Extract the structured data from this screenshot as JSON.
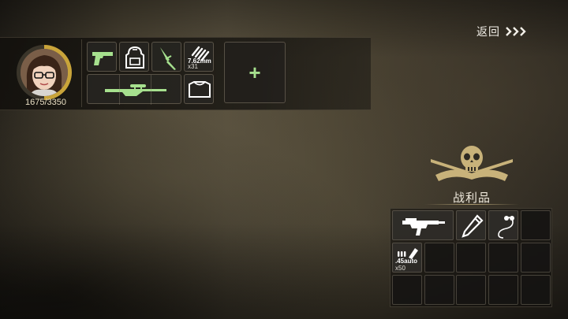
{
  "header": {
    "back_label": "返回",
    "back_icon": "triple-chevron-right-icon"
  },
  "player": {
    "hp_text": "1675/3350",
    "hp_fraction": 0.5,
    "avatar_icon": "girl-with-glasses-portrait"
  },
  "loadout": {
    "slots": [
      {
        "icon": "pistol-icon",
        "caption": "",
        "count": ""
      },
      {
        "icon": "backpack-icon",
        "caption": "",
        "count": ""
      },
      {
        "icon": "knife-icon",
        "caption": "",
        "count": ""
      },
      {
        "icon": "ammo-icon",
        "caption": "7.62mm",
        "count": "x31"
      },
      {
        "icon": "sniper-rifle-icon",
        "caption": "",
        "count": ""
      },
      {
        "icon": "body-armor-icon",
        "caption": "",
        "count": ""
      }
    ],
    "add_label": "+"
  },
  "loot": {
    "title": "战利品",
    "emblem_icon": "skull-crossed-rifles-emblem",
    "items": [
      {
        "icon": "smg-icon",
        "caption": "",
        "count": ""
      },
      {
        "icon": "pencil-icon",
        "caption": "",
        "count": ""
      },
      {
        "icon": "earphones-icon",
        "caption": "",
        "count": ""
      },
      {
        "icon": "ammo-icon",
        "caption": ".45auto",
        "count": "x50"
      }
    ]
  },
  "colors": {
    "accent_green": "#a6e08e",
    "hp_ring": "#c9a43a",
    "emblem_gold": "#c8b27a"
  }
}
